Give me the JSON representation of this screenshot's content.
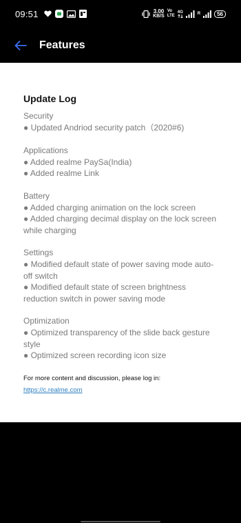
{
  "status_bar": {
    "time": "09:51",
    "net_speed_value": "3.00",
    "net_speed_unit": "KB/S",
    "volte_top": "Vo",
    "volte_bottom": "LTE",
    "network_type": "4G",
    "signal_label": "R",
    "battery_level": "56"
  },
  "app_bar": {
    "title": "Features",
    "back_icon": "back-arrow-icon",
    "accent_color": "#3d6ff5"
  },
  "update_log": {
    "title": "Update Log",
    "sections": [
      {
        "name": "Security",
        "items": [
          "● Updated Andriod security patch（2020#6)"
        ]
      },
      {
        "name": "Applications",
        "items": [
          "● Added realme PaySa(India)",
          "● Added realme Link"
        ]
      },
      {
        "name": "Battery",
        "items": [
          "● Added charging animation on the lock screen",
          "● Added charging decimal display on the lock screen while charging"
        ]
      },
      {
        "name": "Settings",
        "items": [
          "● Modified default state of power saving mode auto-off switch",
          "● Modified default state of screen brightness reduction switch in power saving mode"
        ]
      },
      {
        "name": "Optimization",
        "items": [
          "● Optimized transparency of the slide back gesture style",
          "● Optimized screen recording icon size"
        ]
      }
    ],
    "footer_text": "For more content and discussion, please log in:",
    "footer_link": "https://c.realme.com"
  }
}
